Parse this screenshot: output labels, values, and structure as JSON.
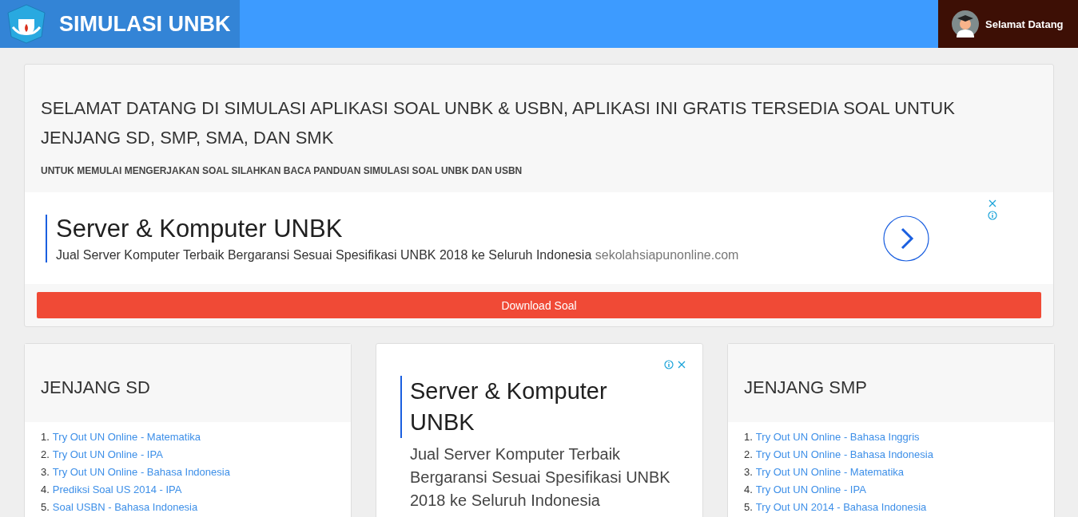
{
  "header": {
    "title": "SIMULASI UNBK",
    "user": "Selamat Datang"
  },
  "welcome": {
    "heading": "SELAMAT DATANG DI SIMULASI APLIKASI SOAL UNBK & USBN, APLIKASI INI GRATIS TERSEDIA SOAL UNTUK JENJANG SD, SMP, SMA, DAN SMK",
    "subheading": "UNTUK MEMULAI MENGERJAKAN SOAL SILAHKAN BACA PANDUAN SIMULASI SOAL UNBK DAN USBN",
    "ad": {
      "title": "Server & Komputer UNBK",
      "text": "Jual Server Komputer Terbaik Bergaransi Sesuai Spesifikasi UNBK 2018 ke Seluruh Indonesia",
      "domain": "sekolahsiapunonline.com"
    },
    "button": "Download Soal"
  },
  "columns": [
    {
      "kind": "list",
      "title": "JENJANG SD",
      "items": [
        {
          "number": "1.",
          "label": "Try Out UN Online - Matematika"
        },
        {
          "number": "2.",
          "label": "Try Out UN Online - IPA"
        },
        {
          "number": "3.",
          "label": "Try Out UN Online - Bahasa Indonesia"
        },
        {
          "number": "4.",
          "label": "Prediksi Soal US 2014 - IPA"
        },
        {
          "number": "5.",
          "label": "Soal USBN - Bahasa Indonesia"
        }
      ]
    },
    {
      "kind": "ad",
      "title": "Server & Komputer UNBK",
      "text": "Jual Server Komputer Terbaik Bergaransi Sesuai Spesifikasi UNBK 2018 ke Seluruh Indonesia"
    },
    {
      "kind": "list",
      "title": "JENJANG SMP",
      "items": [
        {
          "number": "1.",
          "label": "Try Out UN Online - Bahasa Inggris"
        },
        {
          "number": "2.",
          "label": "Try Out UN Online - Bahasa Indonesia"
        },
        {
          "number": "3.",
          "label": "Try Out UN Online - Matematika"
        },
        {
          "number": "4.",
          "label": "Try Out UN Online - IPA"
        },
        {
          "number": "5.",
          "label": "Try Out UN 2014 - Bahasa Indonesia"
        }
      ]
    }
  ]
}
